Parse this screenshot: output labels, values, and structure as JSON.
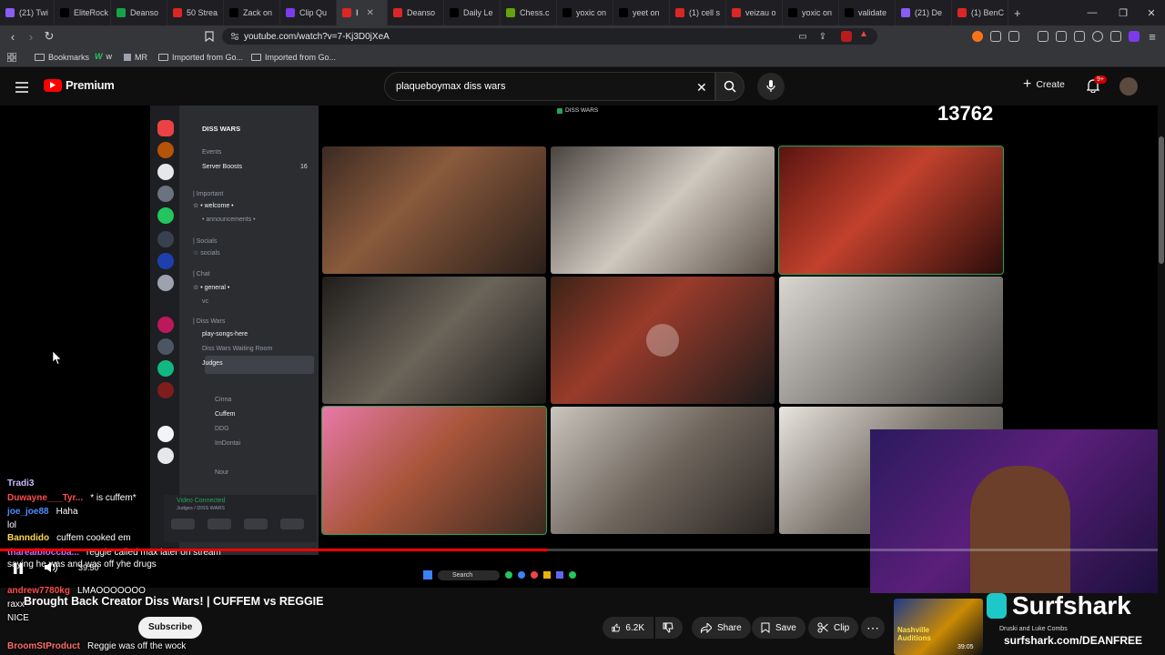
{
  "browser": {
    "tabs": [
      {
        "label": "(21) Twi",
        "color": "#8b5cf6"
      },
      {
        "label": "EliteRock",
        "color": "#000000"
      },
      {
        "label": "Deanso",
        "color": "#16a34a"
      },
      {
        "label": "50 Strea",
        "color": "#dc2626"
      },
      {
        "label": "Zack on",
        "color": "#000000"
      },
      {
        "label": "Clip Qu",
        "color": "#7c3aed"
      },
      {
        "label": "I",
        "color": "#dc2626",
        "active": true
      },
      {
        "label": "Deanso",
        "color": "#dc2626"
      },
      {
        "label": "Daily Le",
        "color": "#000000"
      },
      {
        "label": "Chess.c",
        "color": "#65a30d"
      },
      {
        "label": "yoxic on",
        "color": "#000000"
      },
      {
        "label": "yeet on",
        "color": "#000000"
      },
      {
        "label": "(1) cell s",
        "color": "#dc2626"
      },
      {
        "label": "veizau o",
        "color": "#dc2626"
      },
      {
        "label": "yoxic on",
        "color": "#000000"
      },
      {
        "label": "validate",
        "color": "#000000"
      },
      {
        "label": "(21) De",
        "color": "#8b5cf6"
      },
      {
        "label": "(1) BenC",
        "color": "#dc2626"
      }
    ],
    "new_tab": "+",
    "url": "youtube.com/watch?v=7-Kj3D0jXeA",
    "bookmarks": [
      "Bookmarks",
      "w",
      "MR",
      "Imported from Go...",
      "Imported from Go..."
    ]
  },
  "youtube": {
    "logo": "Premium",
    "search_value": "plaqueboymax diss wars",
    "create_label": "Create",
    "notif_badge": "9+",
    "video_title": "Brought Back Creator Diss Wars! | CUFFEM vs REGGIE",
    "time_text": "39:50",
    "subscribe_label": "Subscribe",
    "likes": "6.2K",
    "share_label": "Share",
    "save_label": "Save",
    "clip_label": "Clip",
    "progress": 0.47
  },
  "stream": {
    "viewer_count": "13762",
    "top_label": "DISS WARS",
    "server_name": "DISS WARS",
    "channels": [
      {
        "label": "Events"
      },
      {
        "label": "Server Boosts",
        "badge": "16"
      },
      {
        "label": "| Important"
      },
      {
        "label": "☆ • welcome •"
      },
      {
        "label": "• announcements •"
      },
      {
        "label": "| Socials"
      },
      {
        "label": "☆ socials"
      },
      {
        "label": "| Chat"
      },
      {
        "label": "☆ • general •"
      },
      {
        "label": "vc"
      },
      {
        "label": "| Diss Wars"
      },
      {
        "label": "play-songs-here"
      },
      {
        "label": "Diss Wars Waiting Room"
      },
      {
        "label": "Judges"
      },
      {
        "label": "Cinna"
      },
      {
        "label": "Cuffem"
      },
      {
        "label": "DDG"
      },
      {
        "label": "ImDontai"
      },
      {
        "label": "Nour"
      }
    ],
    "voice_status": "Video Connected",
    "voice_sub": "Judges / DISS WARS",
    "taskbar_search": "Search",
    "chat": [
      {
        "user": "Tradi3",
        "user_color": "#c7b8ff",
        "text": ""
      },
      {
        "user": "Duwayne___Tyr...",
        "user_color": "#ff4d4d",
        "text": "* is cuffem*"
      },
      {
        "user": "joe_joe88",
        "user_color": "#4d8dff",
        "text": "Haha"
      },
      {
        "user": "",
        "user_color": "#4d8dff",
        "text": "lol"
      },
      {
        "user": "Banndido",
        "user_color": "#ffd84d",
        "text": "cuffem cooked em"
      },
      {
        "user": "tharealbloccba...",
        "user_color": "#d46bff",
        "text": "reggie called max later on stream saying he was and was off yhe drugs"
      },
      {
        "user": "andrew7780kg",
        "user_color": "#ff4d4d",
        "text": "LMAOOOOOOO"
      },
      {
        "user": "",
        "user_color": "#ffffff",
        "text": "raxx"
      },
      {
        "user": "",
        "user_color": "#ff9c4d",
        "text": "NICE"
      },
      {
        "user": "BroomStProduct",
        "user_color": "#ff6b6b",
        "text": "Reggie was off the wock"
      }
    ]
  },
  "ad": {
    "brand": "Surfshark",
    "url": "surfshark.com/DEANFREE",
    "tags": [
      "Nashville Auditions",
      "Druski and Luke Combs"
    ],
    "time": "39:05"
  },
  "colors": {
    "accent": "#ff0000",
    "discord_bg": "#2b2d31"
  }
}
